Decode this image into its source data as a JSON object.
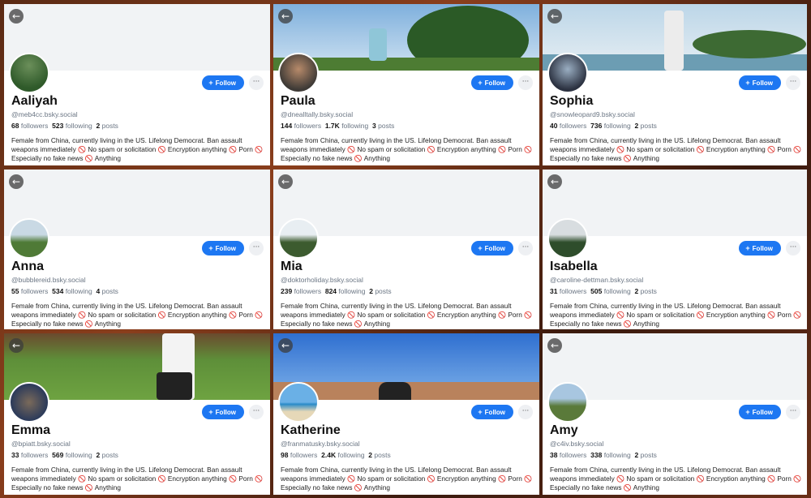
{
  "ui": {
    "back_icon": "←",
    "follow_plus": "+",
    "more_icon": "···",
    "prohibited_icon": "🚫"
  },
  "bio_parts": {
    "part1": "Female from China, currently living in the US. Lifelong Democrat. Ban assault weapons immediately",
    "part2": " No spam or solicitation",
    "part3": " Encryption anything",
    "part4": " Porn",
    "part5": " Especially no fake news",
    "part6": " Anything"
  },
  "profiles": [
    {
      "name": "Aaliyah",
      "handle": "@meb4cc.bsky.social",
      "followers": "68",
      "followers_label": "followers",
      "following": "523",
      "following_label": "following",
      "posts": "2",
      "posts_label": "posts",
      "follow_label": "Follow"
    },
    {
      "name": "Paula",
      "handle": "@dnealltally.bsky.social",
      "followers": "144",
      "followers_label": "followers",
      "following": "1.7K",
      "following_label": "following",
      "posts": "3",
      "posts_label": "posts",
      "follow_label": "Follow"
    },
    {
      "name": "Sophia",
      "handle": "@snowleopard9.bsky.social",
      "followers": "40",
      "followers_label": "followers",
      "following": "736",
      "following_label": "following",
      "posts": "2",
      "posts_label": "posts",
      "follow_label": "Follow"
    },
    {
      "name": "Anna",
      "handle": "@bubblereid.bsky.social",
      "followers": "55",
      "followers_label": "followers",
      "following": "534",
      "following_label": "following",
      "posts": "4",
      "posts_label": "posts",
      "follow_label": "Follow"
    },
    {
      "name": "Mia",
      "handle": "@doktorholiday.bsky.social",
      "followers": "239",
      "followers_label": "followers",
      "following": "824",
      "following_label": "following",
      "posts": "2",
      "posts_label": "posts",
      "follow_label": "Follow"
    },
    {
      "name": "Isabella",
      "handle": "@caroline-dettman.bsky.social",
      "followers": "31",
      "followers_label": "followers",
      "following": "505",
      "following_label": "following",
      "posts": "2",
      "posts_label": "posts",
      "follow_label": "Follow"
    },
    {
      "name": "Emma",
      "handle": "@bpiatt.bsky.social",
      "followers": "33",
      "followers_label": "followers",
      "following": "569",
      "following_label": "following",
      "posts": "2",
      "posts_label": "posts",
      "follow_label": "Follow"
    },
    {
      "name": "Katherine",
      "handle": "@franmatusky.bsky.social",
      "followers": "98",
      "followers_label": "followers",
      "following": "2.4K",
      "following_label": "following",
      "posts": "2",
      "posts_label": "posts",
      "follow_label": "Follow"
    },
    {
      "name": "Amy",
      "handle": "@c4iv.bsky.social",
      "followers": "38",
      "followers_label": "followers",
      "following": "338",
      "following_label": "following",
      "posts": "2",
      "posts_label": "posts",
      "follow_label": "Follow"
    }
  ]
}
